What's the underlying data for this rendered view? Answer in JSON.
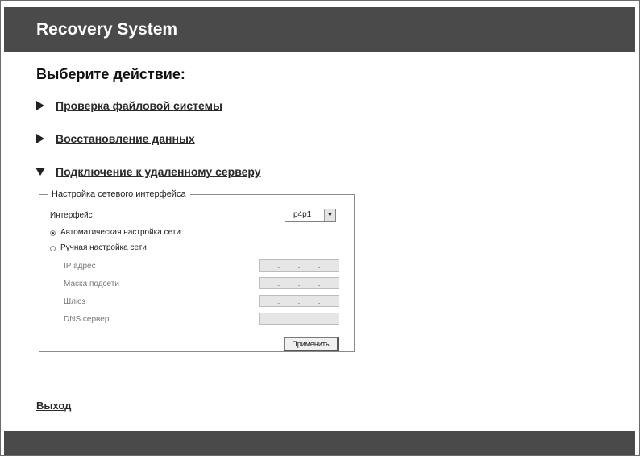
{
  "header": {
    "title": "Recovery System"
  },
  "page_title": "Выберите действие:",
  "actions": [
    {
      "label": "Проверка файловой системы",
      "expanded": false
    },
    {
      "label": "Восстановление данных",
      "expanded": false
    },
    {
      "label": "Подключение к удаленному серверу",
      "expanded": true
    }
  ],
  "network": {
    "legend": "Настройка сетевого интерфейса",
    "interface_label": "Интерфейс",
    "interface_value": "p4p1",
    "radio_auto": {
      "label": "Автоматическая настройка сети",
      "checked": true
    },
    "radio_manual": {
      "label": "Ручная настройка сети",
      "checked": false
    },
    "fields": [
      {
        "label": "IP адрес",
        "value": ".  .  ."
      },
      {
        "label": "Маска подсети",
        "value": ".  .  ."
      },
      {
        "label": "Шлюз",
        "value": ".  .  ."
      },
      {
        "label": "DNS сервер",
        "value": ".  .  ."
      }
    ],
    "apply_label": "Применить"
  },
  "exit_label": "Выход",
  "icons": {
    "collapsed": "triangle-right-icon",
    "expanded": "triangle-down-icon",
    "dropdown": "dropdown-arrow-icon"
  }
}
